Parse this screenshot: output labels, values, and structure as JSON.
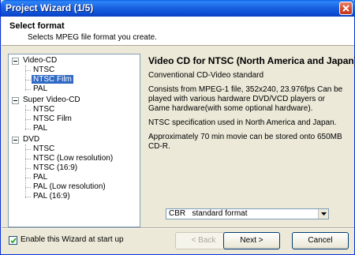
{
  "window": {
    "title": "Project Wizard (1/5)",
    "close_icon": "close-icon"
  },
  "header": {
    "title": "Select format",
    "subtitle": "Selects MPEG file format you create."
  },
  "tree": {
    "groups": [
      {
        "label": "Video-CD",
        "items": [
          "NTSC",
          "NTSC Film",
          "PAL"
        ]
      },
      {
        "label": "Super Video-CD",
        "items": [
          "NTSC",
          "NTSC Film",
          "PAL"
        ]
      },
      {
        "label": "DVD",
        "items": [
          "NTSC",
          "NTSC (Low resolution)",
          "NTSC (16:9)",
          "PAL",
          "PAL (Low resolution)",
          "PAL (16:9)"
        ]
      }
    ],
    "selected": "Video-CD / NTSC Film"
  },
  "detail": {
    "title": "Video CD for NTSC (North America and Japan)",
    "paragraphs": [
      "Conventional CD-Video standard",
      "Consists from MPEG-1 file, 352x240, 23.976fps Can be played with various hardware DVD/VCD players or Game hardware(with some optional hardware).",
      "NTSC specification used in North America and Japan.",
      "Approximately 70 min movie can be stored onto 650MB CD-R."
    ],
    "format_select": {
      "value": "CBR   standard format"
    }
  },
  "footer": {
    "enable_wizard_label": "Enable this Wizard at start up",
    "enable_wizard_checked": true,
    "back_label": "< Back",
    "next_label": "Next >",
    "cancel_label": "Cancel"
  }
}
